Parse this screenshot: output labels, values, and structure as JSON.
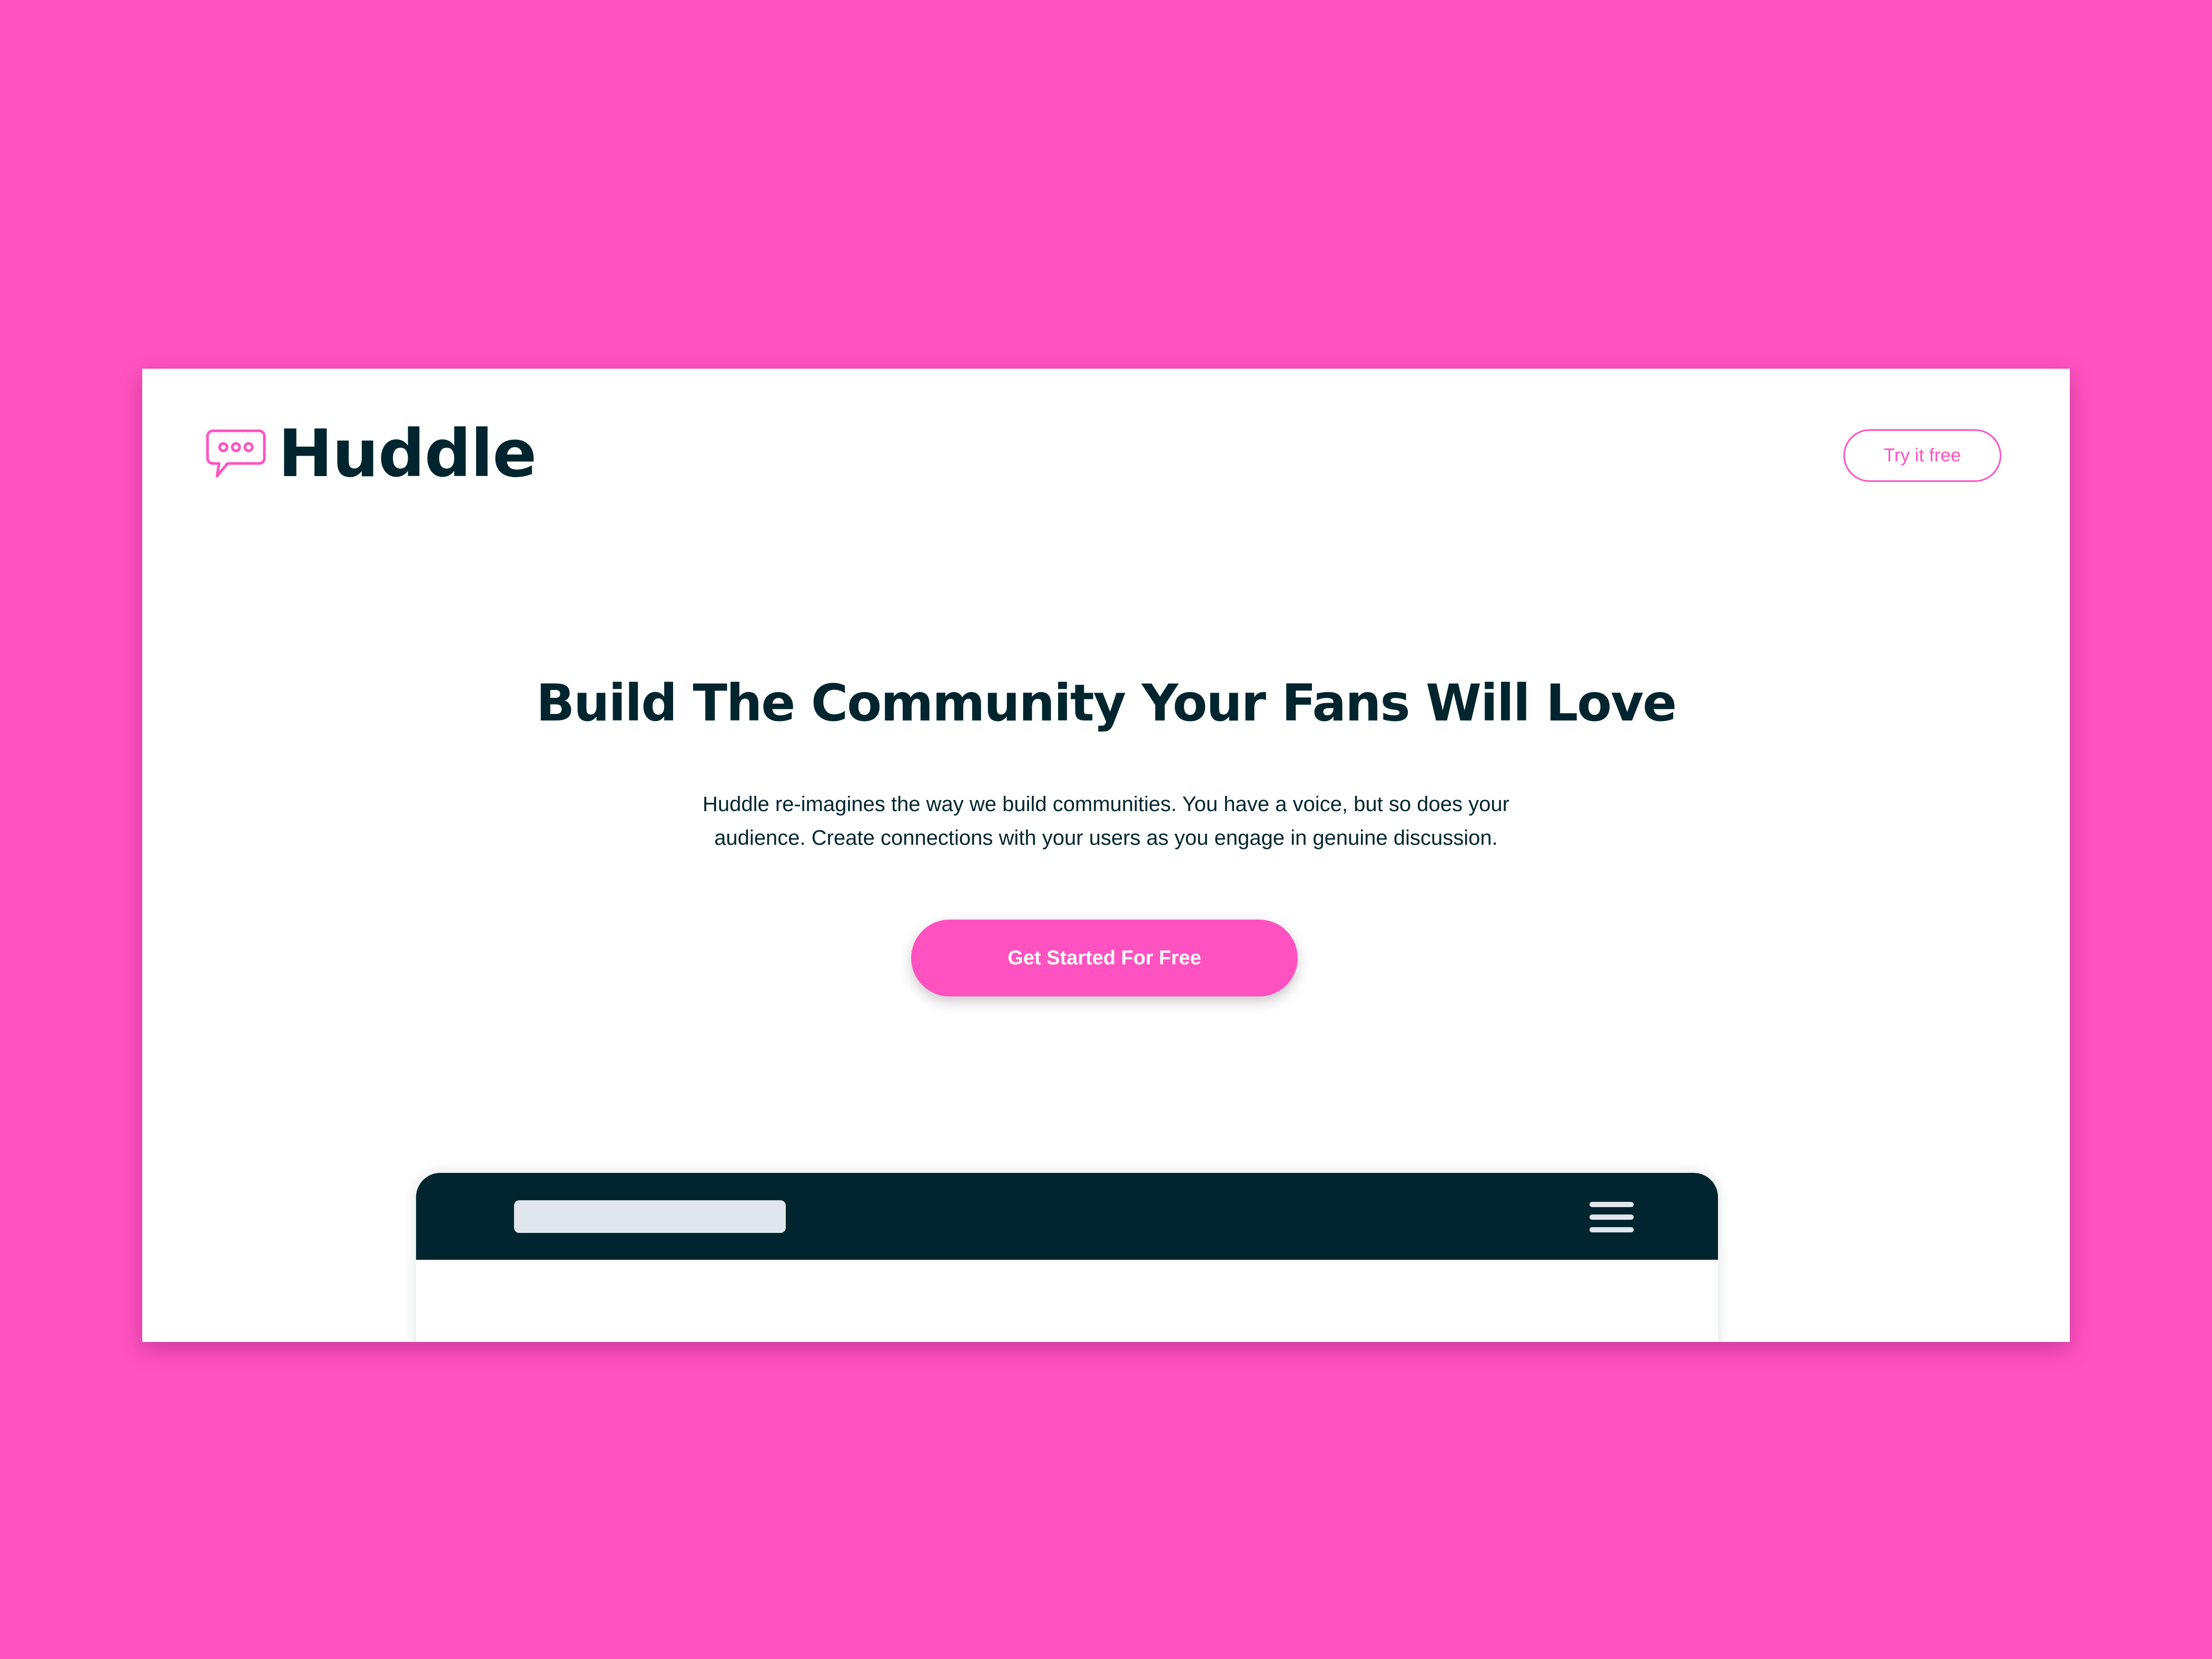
{
  "colors": {
    "background": "#FF52C1",
    "accent": "#FF52C1",
    "dark": "#00252E",
    "surface": "#FFFFFF",
    "placeholder": "#E0E6EB",
    "menu_lines": "#E0E6EB"
  },
  "header": {
    "logo_icon": "chat-bubble-icon",
    "logo_text": "Huddle",
    "try_button_label": "Try it free"
  },
  "hero": {
    "title": "Build The Community Your Fans Will Love",
    "description": "Huddle re-imagines the way we build communities. You have a voice, but so does your audience. Create connections with your users as you engage in genuine discussion.",
    "cta_label": "Get Started For Free"
  },
  "mockup": {
    "menu_icon": "hamburger-menu-icon"
  }
}
